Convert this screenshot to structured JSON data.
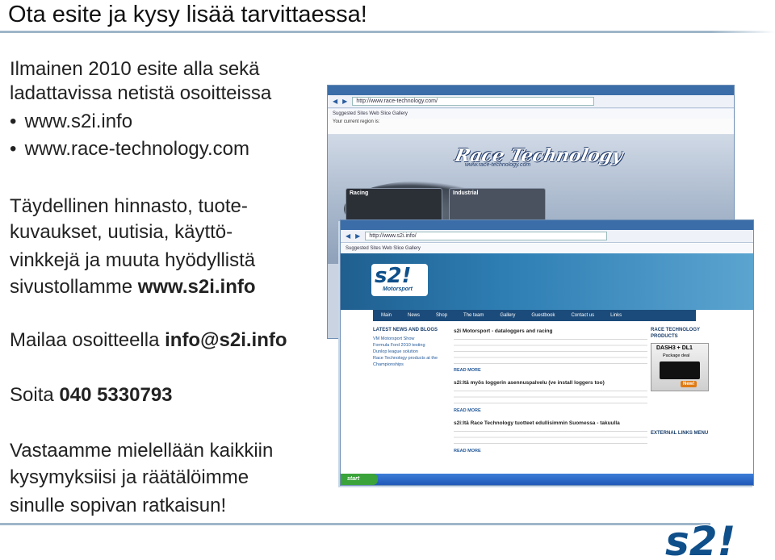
{
  "slide": {
    "title": "Ota esite ja kysy lisää tarvittaessa!",
    "intro_line1": "Ilmainen 2010 esite alla sekä",
    "intro_line2": "ladattavissa netistä osoitteissa",
    "bullets": [
      "www.s2i.info",
      "www.race-technology.com"
    ],
    "para_line1": "Täydellinen hinnasto, tuote-",
    "para_line2": "kuvaukset, uutisia,  käyttö-",
    "para_line3": "vinkkejä ja muuta hyödyllistä",
    "para_line4_text": "sivustollamme ",
    "para_line4_bold": "www.s2i.info",
    "mail_text": "Mailaa osoitteella ",
    "mail_bold": "info@s2i.info",
    "phone_text": "Soita ",
    "phone_bold": "040 5330793",
    "closing_line1": "Vastaamme mielellään kaikkiin",
    "closing_line2": "kysymyksiisi ja räätälöimme",
    "closing_line3": "sinulle sopivan ratkaisun!"
  },
  "colors": {
    "rule": "#9fb6c9",
    "s2_blue": "#0f4f8a"
  },
  "shot_race": {
    "url": "http://www.race-technology.com/",
    "favs": "Suggested Sites   Web Slice Gallery",
    "region": "Your current region is:",
    "logo": "Race Technology",
    "logo_url": "www.race-technology.com",
    "card1": "Racing",
    "card2": "Industrial"
  },
  "shot_s2i": {
    "url": "http://www.s2i.info/",
    "favs": "Suggested Sites   Web Slice Gallery",
    "logo": "s2!",
    "logo_sub": "Motorsport",
    "menu": [
      "Main",
      "News",
      "Shop",
      "The team",
      "Gallery",
      "Guestbook",
      "Contact us",
      "Links"
    ],
    "left_heading": "LATEST NEWS AND BLOGS",
    "left_items": [
      "VM Motorsport Show",
      "Formula Ford 2010 testing",
      "Dunlop league solution",
      "Race Technology products at the",
      "Championships"
    ],
    "mid_heading1": "s2i Motorsport - dataloggers and racing",
    "mid_heading2": "s2i:ltä myös loggerin asennuspalvelu (ve install loggers too)",
    "mid_heading3": "s2i:ltä Race Technology tuotteet edullisimmin Suomessa - takuulla",
    "more": "READ MORE",
    "right_heading": "RACE TECHNOLOGY PRODUCTS",
    "dash_title": "DASH3 + DL1",
    "dash_sub": "Package deal",
    "dash_badge": "New!",
    "right_heading2": "EXTERNAL LINKS MENU",
    "start": "start"
  }
}
